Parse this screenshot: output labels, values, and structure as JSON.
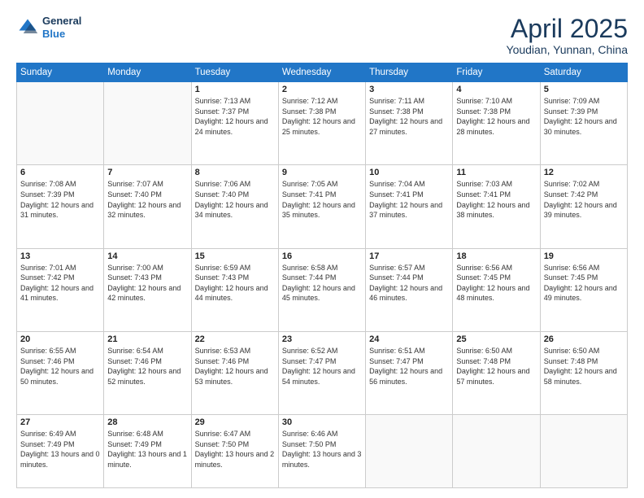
{
  "header": {
    "logo_line1": "General",
    "logo_line2": "Blue",
    "month_title": "April 2025",
    "location": "Youdian, Yunnan, China"
  },
  "weekdays": [
    "Sunday",
    "Monday",
    "Tuesday",
    "Wednesday",
    "Thursday",
    "Friday",
    "Saturday"
  ],
  "weeks": [
    [
      {
        "num": "",
        "sunrise": "",
        "sunset": "",
        "daylight": ""
      },
      {
        "num": "",
        "sunrise": "",
        "sunset": "",
        "daylight": ""
      },
      {
        "num": "1",
        "sunrise": "Sunrise: 7:13 AM",
        "sunset": "Sunset: 7:37 PM",
        "daylight": "Daylight: 12 hours and 24 minutes."
      },
      {
        "num": "2",
        "sunrise": "Sunrise: 7:12 AM",
        "sunset": "Sunset: 7:38 PM",
        "daylight": "Daylight: 12 hours and 25 minutes."
      },
      {
        "num": "3",
        "sunrise": "Sunrise: 7:11 AM",
        "sunset": "Sunset: 7:38 PM",
        "daylight": "Daylight: 12 hours and 27 minutes."
      },
      {
        "num": "4",
        "sunrise": "Sunrise: 7:10 AM",
        "sunset": "Sunset: 7:38 PM",
        "daylight": "Daylight: 12 hours and 28 minutes."
      },
      {
        "num": "5",
        "sunrise": "Sunrise: 7:09 AM",
        "sunset": "Sunset: 7:39 PM",
        "daylight": "Daylight: 12 hours and 30 minutes."
      }
    ],
    [
      {
        "num": "6",
        "sunrise": "Sunrise: 7:08 AM",
        "sunset": "Sunset: 7:39 PM",
        "daylight": "Daylight: 12 hours and 31 minutes."
      },
      {
        "num": "7",
        "sunrise": "Sunrise: 7:07 AM",
        "sunset": "Sunset: 7:40 PM",
        "daylight": "Daylight: 12 hours and 32 minutes."
      },
      {
        "num": "8",
        "sunrise": "Sunrise: 7:06 AM",
        "sunset": "Sunset: 7:40 PM",
        "daylight": "Daylight: 12 hours and 34 minutes."
      },
      {
        "num": "9",
        "sunrise": "Sunrise: 7:05 AM",
        "sunset": "Sunset: 7:41 PM",
        "daylight": "Daylight: 12 hours and 35 minutes."
      },
      {
        "num": "10",
        "sunrise": "Sunrise: 7:04 AM",
        "sunset": "Sunset: 7:41 PM",
        "daylight": "Daylight: 12 hours and 37 minutes."
      },
      {
        "num": "11",
        "sunrise": "Sunrise: 7:03 AM",
        "sunset": "Sunset: 7:41 PM",
        "daylight": "Daylight: 12 hours and 38 minutes."
      },
      {
        "num": "12",
        "sunrise": "Sunrise: 7:02 AM",
        "sunset": "Sunset: 7:42 PM",
        "daylight": "Daylight: 12 hours and 39 minutes."
      }
    ],
    [
      {
        "num": "13",
        "sunrise": "Sunrise: 7:01 AM",
        "sunset": "Sunset: 7:42 PM",
        "daylight": "Daylight: 12 hours and 41 minutes."
      },
      {
        "num": "14",
        "sunrise": "Sunrise: 7:00 AM",
        "sunset": "Sunset: 7:43 PM",
        "daylight": "Daylight: 12 hours and 42 minutes."
      },
      {
        "num": "15",
        "sunrise": "Sunrise: 6:59 AM",
        "sunset": "Sunset: 7:43 PM",
        "daylight": "Daylight: 12 hours and 44 minutes."
      },
      {
        "num": "16",
        "sunrise": "Sunrise: 6:58 AM",
        "sunset": "Sunset: 7:44 PM",
        "daylight": "Daylight: 12 hours and 45 minutes."
      },
      {
        "num": "17",
        "sunrise": "Sunrise: 6:57 AM",
        "sunset": "Sunset: 7:44 PM",
        "daylight": "Daylight: 12 hours and 46 minutes."
      },
      {
        "num": "18",
        "sunrise": "Sunrise: 6:56 AM",
        "sunset": "Sunset: 7:45 PM",
        "daylight": "Daylight: 12 hours and 48 minutes."
      },
      {
        "num": "19",
        "sunrise": "Sunrise: 6:56 AM",
        "sunset": "Sunset: 7:45 PM",
        "daylight": "Daylight: 12 hours and 49 minutes."
      }
    ],
    [
      {
        "num": "20",
        "sunrise": "Sunrise: 6:55 AM",
        "sunset": "Sunset: 7:46 PM",
        "daylight": "Daylight: 12 hours and 50 minutes."
      },
      {
        "num": "21",
        "sunrise": "Sunrise: 6:54 AM",
        "sunset": "Sunset: 7:46 PM",
        "daylight": "Daylight: 12 hours and 52 minutes."
      },
      {
        "num": "22",
        "sunrise": "Sunrise: 6:53 AM",
        "sunset": "Sunset: 7:46 PM",
        "daylight": "Daylight: 12 hours and 53 minutes."
      },
      {
        "num": "23",
        "sunrise": "Sunrise: 6:52 AM",
        "sunset": "Sunset: 7:47 PM",
        "daylight": "Daylight: 12 hours and 54 minutes."
      },
      {
        "num": "24",
        "sunrise": "Sunrise: 6:51 AM",
        "sunset": "Sunset: 7:47 PM",
        "daylight": "Daylight: 12 hours and 56 minutes."
      },
      {
        "num": "25",
        "sunrise": "Sunrise: 6:50 AM",
        "sunset": "Sunset: 7:48 PM",
        "daylight": "Daylight: 12 hours and 57 minutes."
      },
      {
        "num": "26",
        "sunrise": "Sunrise: 6:50 AM",
        "sunset": "Sunset: 7:48 PM",
        "daylight": "Daylight: 12 hours and 58 minutes."
      }
    ],
    [
      {
        "num": "27",
        "sunrise": "Sunrise: 6:49 AM",
        "sunset": "Sunset: 7:49 PM",
        "daylight": "Daylight: 13 hours and 0 minutes."
      },
      {
        "num": "28",
        "sunrise": "Sunrise: 6:48 AM",
        "sunset": "Sunset: 7:49 PM",
        "daylight": "Daylight: 13 hours and 1 minute."
      },
      {
        "num": "29",
        "sunrise": "Sunrise: 6:47 AM",
        "sunset": "Sunset: 7:50 PM",
        "daylight": "Daylight: 13 hours and 2 minutes."
      },
      {
        "num": "30",
        "sunrise": "Sunrise: 6:46 AM",
        "sunset": "Sunset: 7:50 PM",
        "daylight": "Daylight: 13 hours and 3 minutes."
      },
      {
        "num": "",
        "sunrise": "",
        "sunset": "",
        "daylight": ""
      },
      {
        "num": "",
        "sunrise": "",
        "sunset": "",
        "daylight": ""
      },
      {
        "num": "",
        "sunrise": "",
        "sunset": "",
        "daylight": ""
      }
    ]
  ]
}
